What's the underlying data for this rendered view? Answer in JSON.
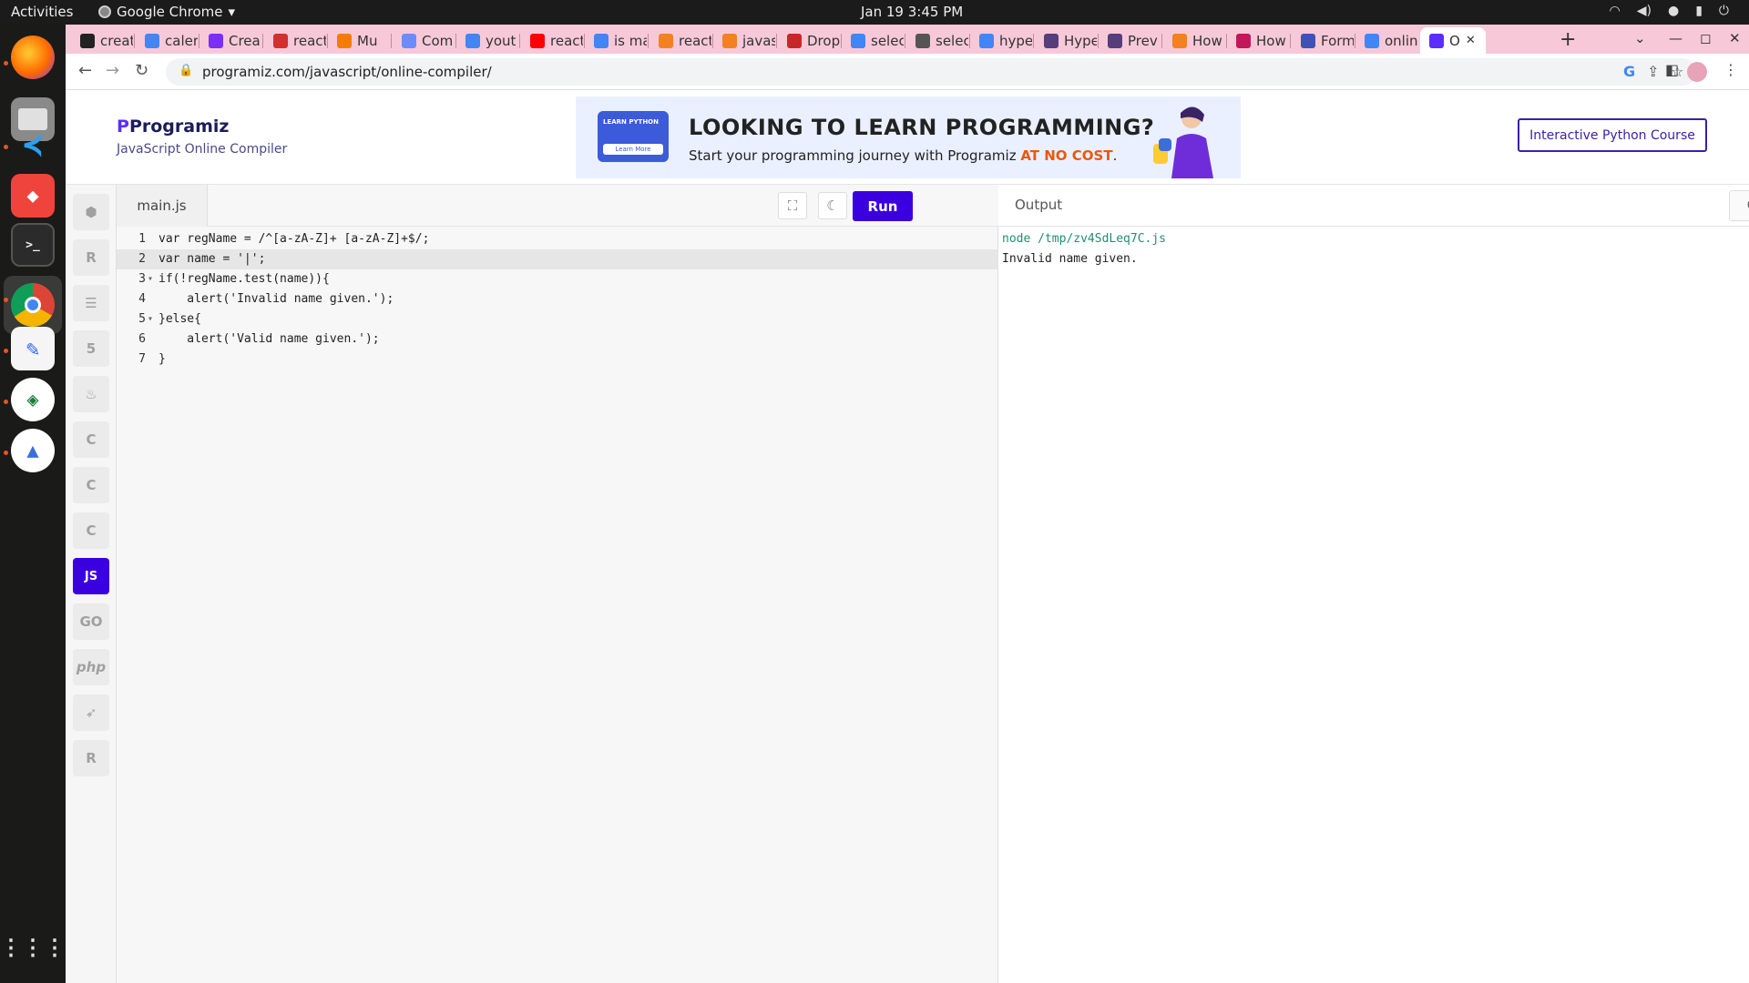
{
  "system": {
    "activities": "Activities",
    "app_name": "Google Chrome",
    "clock": "Jan 19  3:45 PM",
    "tray": [
      "wifi",
      "volume",
      "mic",
      "battery"
    ]
  },
  "dock": {
    "apps": [
      "firefox",
      "files",
      "vscode",
      "anydesk",
      "terminal",
      "chrome",
      "text-editor",
      "remmina",
      "android-studio"
    ],
    "grid_label": "Show Applications"
  },
  "browser": {
    "tabs": [
      {
        "title": "creat",
        "fav_color": "#222222"
      },
      {
        "title": "caler",
        "fav_color": "#4285f4"
      },
      {
        "title": "Crea",
        "fav_color": "#7b2ff7"
      },
      {
        "title": "react",
        "fav_color": "#d32f2f"
      },
      {
        "title": "Mu",
        "fav_color": "#f57c00"
      },
      {
        "title": "Com",
        "fav_color": "#6b8cff"
      },
      {
        "title": "yout",
        "fav_color": "#4285f4"
      },
      {
        "title": "react",
        "fav_color": "#ff0000"
      },
      {
        "title": "is ma",
        "fav_color": "#4285f4"
      },
      {
        "title": "react",
        "fav_color": "#f48024"
      },
      {
        "title": "javas",
        "fav_color": "#f48024"
      },
      {
        "title": "Drop",
        "fav_color": "#c62828"
      },
      {
        "title": "selec",
        "fav_color": "#4285f4"
      },
      {
        "title": "selec",
        "fav_color": "#555555"
      },
      {
        "title": "hype",
        "fav_color": "#4285f4"
      },
      {
        "title": "Hype",
        "fav_color": "#563d7c"
      },
      {
        "title": "Prev",
        "fav_color": "#563d7c"
      },
      {
        "title": "How",
        "fav_color": "#f48024"
      },
      {
        "title": "How",
        "fav_color": "#c2185b"
      },
      {
        "title": "Form",
        "fav_color": "#3f51b5"
      },
      {
        "title": "onlin",
        "fav_color": "#4285f4"
      },
      {
        "title": "O",
        "fav_color": "#5c2dff",
        "active": true
      }
    ],
    "url": "programiz.com/javascript/online-compiler/"
  },
  "site": {
    "logo": "Programiz",
    "subtitle": "JavaScript Online Compiler",
    "banner": {
      "badge_top": "LEARN PYTHON",
      "badge_button": "Learn More",
      "headline": "LOOKING TO LEARN PROGRAMMING?",
      "subline_prefix": "Start your programming journey with Programiz ",
      "subline_emphasis": "AT NO COST",
      "subline_suffix": "."
    },
    "course_button": "Interactive Python Course",
    "languages": [
      "python",
      "r",
      "sql",
      "html",
      "java",
      "c",
      "cplusplus",
      "csharp",
      "JS",
      "GO",
      "php",
      "swift",
      "rust"
    ],
    "active_language": "JS"
  },
  "editor": {
    "file_name": "main.js",
    "run_label": "Run",
    "lines": [
      {
        "n": "1",
        "fold": "",
        "text": "var regName = /^[a-zA-Z]+ [a-zA-Z]+$/;"
      },
      {
        "n": "2",
        "fold": "",
        "text": "var name = '|';",
        "highlight": true
      },
      {
        "n": "3",
        "fold": "▾",
        "text": "if(!regName.test(name)){"
      },
      {
        "n": "4",
        "fold": "",
        "text": "    alert('Invalid name given.');"
      },
      {
        "n": "5",
        "fold": "▾",
        "text": "}else{"
      },
      {
        "n": "6",
        "fold": "",
        "text": "    alert('Valid name given.');"
      },
      {
        "n": "7",
        "fold": "",
        "text": "}"
      }
    ]
  },
  "output": {
    "title": "Output",
    "clear_label": "Clear",
    "command": "node /tmp/zv4SdLeq7C.js",
    "result": "Invalid name given."
  }
}
